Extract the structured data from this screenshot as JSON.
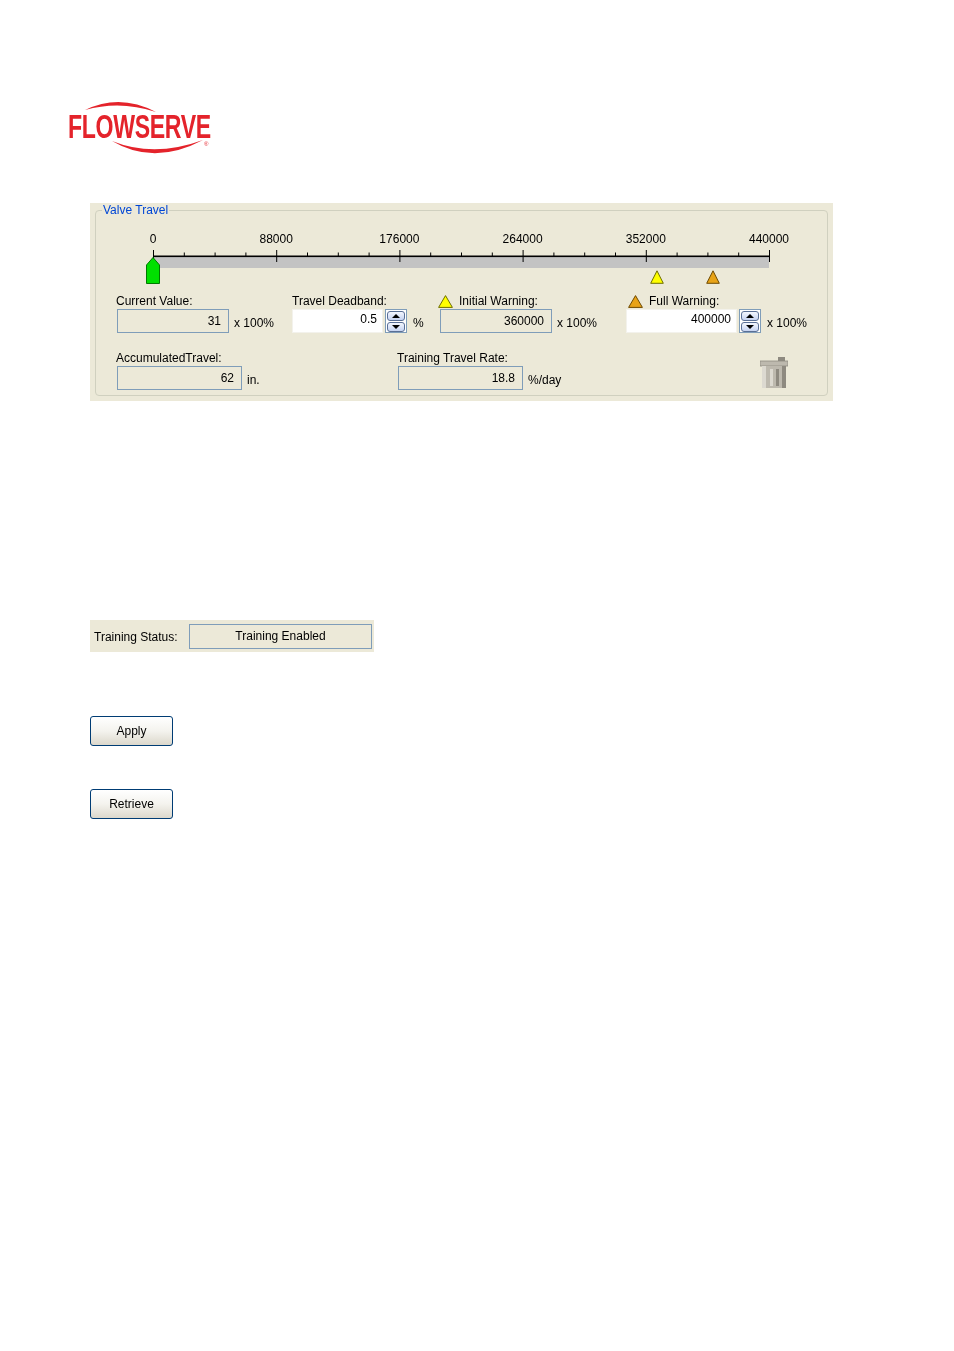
{
  "logo": {
    "text": "FLOWSERVE",
    "mark": "®"
  },
  "valve_travel": {
    "title": "Valve Travel",
    "scale": {
      "tick_labels": [
        "0",
        "88000",
        "176000",
        "264000",
        "352000",
        "440000"
      ],
      "markers": [
        {
          "kind": "current",
          "level": 0.0001
        },
        {
          "kind": "initial",
          "level": 0.818
        },
        {
          "kind": "full",
          "level": 0.909
        }
      ]
    },
    "rows": [
      {
        "fields": [
          {
            "label": "Current Value:",
            "kind": "readonly",
            "value": "31",
            "unit": "x 100%"
          },
          {
            "label": "Travel Deadband:",
            "kind": "spin",
            "value": "0.5",
            "unit": "%"
          },
          {
            "label": "Initial Warning:",
            "kind": "readonly",
            "warning_icon": {
              "kind": "initial"
            },
            "value": "360000",
            "unit": "x 100%"
          },
          {
            "label": "Full Warning:",
            "kind": "spin",
            "warning_icon": {
              "kind": "full"
            },
            "value": "400000",
            "unit": "x 100%"
          }
        ]
      },
      {
        "fields": [
          {
            "label": "AccumulatedTravel:",
            "kind": "readonly",
            "value": "62",
            "unit": "in."
          },
          {
            "label": "Training Travel Rate:",
            "kind": "readonly",
            "value": "18.8",
            "unit": "%/day"
          }
        ]
      }
    ],
    "trash_button": {
      "disabled": true
    }
  },
  "training_status": {
    "label": "Training Status:",
    "value": "Training Enabled"
  },
  "buttons": [
    "Apply",
    "Retrieve"
  ]
}
